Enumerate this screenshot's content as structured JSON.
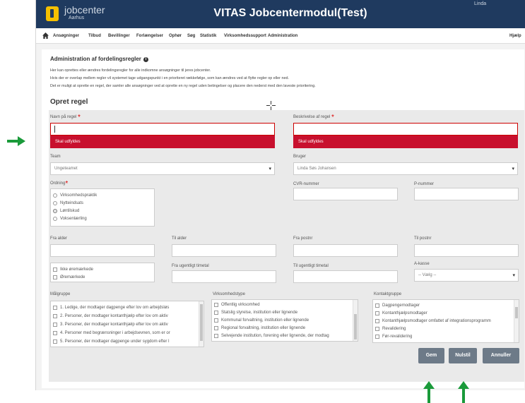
{
  "header": {
    "brand": "jobcenter",
    "brand_sub": "Aarhus",
    "title": "VITAS Jobcentermodul(Test)",
    "user": "Linda"
  },
  "nav": {
    "items": [
      "Ansøgninger",
      "Tilbud",
      "Bevillinger",
      "Forlængelser",
      "Ophør",
      "Søg",
      "Statistik",
      "Virksomhedssupport",
      "Administration"
    ],
    "help": "Hjælp"
  },
  "page": {
    "title": "Administration af fordelingsregler",
    "info_icon": "i",
    "info": [
      "Her kan oprettes eller ændres fordelingsregler for alle indkomne ansøgninger til jeres jobcenter.",
      "Hvis der er overlap mellem regler vil systemet tage udgangspunkt i en prioriteret rækkefølge, som kan ændres ved at flytte regler op eller ned.",
      "Det er muligt at oprette en regel, der samler alle ansøgninger ved at oprette en ny regel uden betingelser og placere den nederst med den laveste prioritering."
    ],
    "section": "Opret regel"
  },
  "form": {
    "name_label": "Navn på regel",
    "desc_label": "Beskrivelse af regel",
    "required": "*",
    "error_text": "Skal udfyldes",
    "team_label": "Team",
    "team_value": "Ungeteamet",
    "user_label": "Bruger",
    "user_value": "Linda Søs Johansen",
    "ordning_label": "Ordning",
    "ordning_options": [
      "Virksomhedspraktik",
      "Nytteindsats",
      "Løntilskud",
      "Voksenlærling"
    ],
    "ordning_selected": 2,
    "cvr_label": "CVR-nummer",
    "p_label": "P-nummer",
    "fra_alder": "Fra alder",
    "til_alder": "Til alder",
    "fra_postnr": "Fra postnr",
    "til_postnr": "Til postnr",
    "earmark_options": [
      "Ikke øremærkede",
      "Øremærkede"
    ],
    "fra_timetal": "Fra ugentligt timetal",
    "til_timetal": "Til ugentligt timetal",
    "akasse_label": "A-kasse",
    "akasse_value": "-- Vælg --",
    "maalgruppe_label": "Målgruppe",
    "maalgruppe": [
      "1. Ledige, der modtager dagpenge efter lov om arbejdsløs",
      "2. Personer, der modtager kontanthjælp efter lov om aktiv",
      "3. Personer, der modtager kontanthjælp efter lov om aktiv",
      "4. Personer med begrænsninger i arbejdsevnen, som er or",
      "5. Personer, der modtager dagpenge under sygdom efter l"
    ],
    "virk_label": "Virksomhedstype",
    "virk": [
      "Offentlig virksomhed",
      "Statslig styrelse, institution eller lignende",
      "Kommunal forvaltning, institution eller lignende",
      "Regional forvaltning, institution eller lignende",
      "Selvejende institution, forening eller lignende, der modtag"
    ],
    "kontakt_label": "Kontaktgruppe",
    "kontakt": [
      "Dagpengemodtager",
      "Kontanthjælpsmodtager",
      "Kontanthjælpsmodtager omfattet af integrationsprogramm",
      "Revalidering",
      "Før-revalidering"
    ],
    "buttons": {
      "save": "Gem",
      "reset": "Nulstil",
      "cancel": "Annuller"
    }
  },
  "colors": {
    "topbar": "#1f3a5f",
    "error": "#c8102e",
    "button": "#6d7a88",
    "arrow": "#1a9a3a",
    "logo": "#f5c000"
  }
}
